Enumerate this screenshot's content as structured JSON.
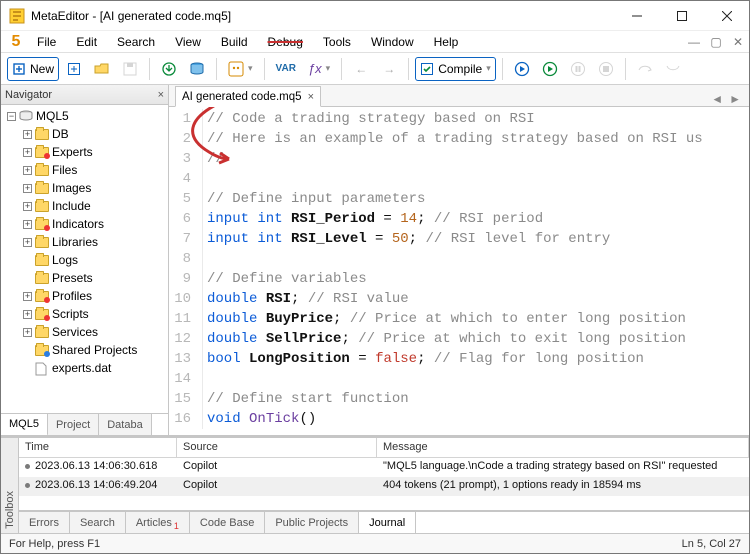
{
  "window": {
    "title": "MetaEditor - [AI generated code.mq5]"
  },
  "menu": {
    "items": [
      "File",
      "Edit",
      "Search",
      "View",
      "Build",
      "Debug",
      "Tools",
      "Window",
      "Help"
    ]
  },
  "toolbar": {
    "new_label": "New",
    "compile_label": "Compile"
  },
  "navigator": {
    "title": "Navigator",
    "root": "MQL5",
    "items": [
      {
        "label": "DB",
        "mark": ""
      },
      {
        "label": "Experts",
        "mark": "dot"
      },
      {
        "label": "Files",
        "mark": ""
      },
      {
        "label": "Images",
        "mark": ""
      },
      {
        "label": "Include",
        "mark": ""
      },
      {
        "label": "Indicators",
        "mark": "dot"
      },
      {
        "label": "Libraries",
        "mark": ""
      },
      {
        "label": "Logs",
        "mark": ""
      },
      {
        "label": "Presets",
        "mark": ""
      },
      {
        "label": "Profiles",
        "mark": "dot"
      },
      {
        "label": "Scripts",
        "mark": "dot"
      },
      {
        "label": "Services",
        "mark": ""
      },
      {
        "label": "Shared Projects",
        "mark": "blue"
      },
      {
        "label": "experts.dat",
        "mark": "file"
      }
    ],
    "tabs": [
      "MQL5",
      "Project",
      "Databa"
    ]
  },
  "editor": {
    "tab": "AI generated code.mq5",
    "lines": {
      "l1": "// Code a trading strategy based on RSI",
      "l2": "// Here is an example of a trading strategy based on RSI us",
      "l3": "//",
      "l5": "// Define input parameters",
      "l6a": "input int ",
      "l6b": "RSI_Period",
      "l6c": " = ",
      "l6d": "14",
      "l6e": "; ",
      "l6f": "// RSI period",
      "l7a": "input int ",
      "l7b": "RSI_Level",
      "l7c": " = ",
      "l7d": "50",
      "l7e": "; ",
      "l7f": "// RSI level for entry",
      "l9": "// Define variables",
      "l10a": "double ",
      "l10b": "RSI",
      "l10c": "; ",
      "l10d": "// RSI value",
      "l11a": "double ",
      "l11b": "BuyPrice",
      "l11c": "; ",
      "l11d": "// Price at which to enter long position",
      "l12a": "double ",
      "l12b": "SellPrice",
      "l12c": "; ",
      "l12d": "// Price at which to exit long position",
      "l13a": "bool ",
      "l13b": "LongPosition",
      "l13c": " = ",
      "l13d": "false",
      "l13e": "; ",
      "l13f": "// Flag for long position",
      "l15": "// Define start function",
      "l16a": "void ",
      "l16b": "OnTick",
      "l16c": "()"
    }
  },
  "journal": {
    "headers": {
      "time": "Time",
      "source": "Source",
      "message": "Message"
    },
    "rows": [
      {
        "time": "2023.06.13 14:06:30.618",
        "source": "Copilot",
        "message": "\"MQL5 language.\\nCode a trading strategy based on RSI\" requested"
      },
      {
        "time": "2023.06.13 14:06:49.204",
        "source": "Copilot",
        "message": "404 tokens (21 prompt), 1 options ready in 18594 ms"
      }
    ],
    "tabs": [
      "Errors",
      "Search",
      "Articles",
      "Code Base",
      "Public Projects",
      "Journal"
    ]
  },
  "status": {
    "help": "For Help, press F1",
    "pos": "Ln 5, Col 27"
  }
}
